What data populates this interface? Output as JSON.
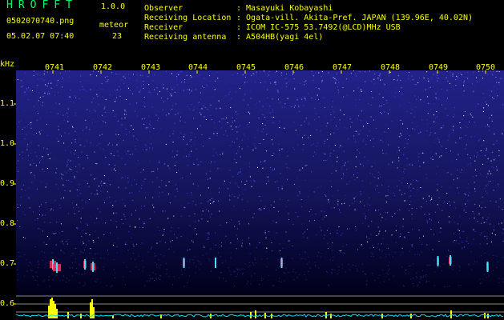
{
  "header": {
    "app_title": "HROFFT",
    "version": "1.0.0",
    "filename": "0502070740.png",
    "datetime": "05.02.07 07:40",
    "meteor_label": "meteor",
    "meteor_count": "23",
    "info": [
      {
        "label": "Observer",
        "value": ": Masayuki Kobayashi"
      },
      {
        "label": "Receiving Location",
        "value": ": Ogata-vill. Akita-Pref. JAPAN (139.96E, 40.02N)"
      },
      {
        "label": "Receiver",
        "value": ": ICOM IC-575 53.7492(@LCD)MHz USB"
      },
      {
        "label": "Receiving antenna",
        "value": ": A504HB(yagi 4el)"
      }
    ]
  },
  "axes": {
    "y_unit": "kHz",
    "y_ticks": [
      "1.1",
      "1.0",
      "0.9",
      "0.8",
      "0.7",
      "0.6"
    ],
    "x_ticks": [
      "0741",
      "0742",
      "0743",
      "0744",
      "0745",
      "0746",
      "0747",
      "0748",
      "0749",
      "0750"
    ]
  },
  "colors": {
    "label": "#ffff00",
    "title": "#00ff66",
    "background_top": "#1a1a7a",
    "background_bottom": "#000018",
    "trace": "#00e5ff",
    "meteor": "#ff3030"
  }
}
